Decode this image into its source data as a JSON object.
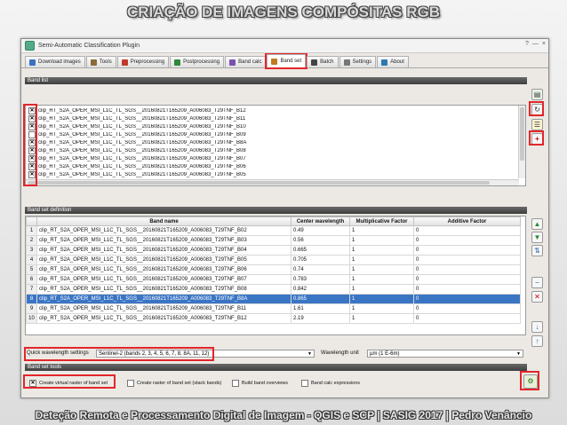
{
  "slide": {
    "title": "CRIAÇÃO DE IMAGENS COMPÓSITAS RGB",
    "footer": "Deteção Remota e Processamento Digital de Imagem - QGIS e SCP   |   SASIG 2017   |   Pedro Venâncio"
  },
  "window": {
    "title": "Semi-Automatic Classification Plugin",
    "controls": [
      "?",
      "—",
      "×"
    ]
  },
  "tabs": [
    {
      "label": "Download images",
      "icon_color": "#3a6fc4",
      "active": false
    },
    {
      "label": "Tools",
      "icon_color": "#8a6a3a",
      "active": false
    },
    {
      "label": "Preprocessing",
      "icon_color": "#c0392b",
      "active": false
    },
    {
      "label": "Postprocessing",
      "icon_color": "#2c8a3a",
      "active": false
    },
    {
      "label": "Band calc",
      "icon_color": "#7a4fb0",
      "active": false
    },
    {
      "label": "Band set",
      "icon_color": "#c07a20",
      "active": true
    },
    {
      "label": "Batch",
      "icon_color": "#444444",
      "active": false
    },
    {
      "label": "Settings",
      "icon_color": "#777777",
      "active": false
    },
    {
      "label": "About",
      "icon_color": "#2a7ab0",
      "active": false
    }
  ],
  "band_list": {
    "header": "Band list",
    "items": [
      {
        "checked": true,
        "name": "clip_RT_S2A_OPER_MSI_L1C_TL_SGS__20160821T165209_A006083_T29TNF_B12"
      },
      {
        "checked": true,
        "name": "clip_RT_S2A_OPER_MSI_L1C_TL_SGS__20160821T165209_A006083_T29TNF_B11"
      },
      {
        "checked": true,
        "name": "clip_RT_S2A_OPER_MSI_L1C_TL_SGS__20160821T165209_A006083_T29TNF_B10"
      },
      {
        "checked": false,
        "name": "clip_RT_S2A_OPER_MSI_L1C_TL_SGS__20160821T165209_A006083_T29TNF_B09"
      },
      {
        "checked": true,
        "name": "clip_RT_S2A_OPER_MSI_L1C_TL_SGS__20160821T165209_A006083_T29TNF_B8A"
      },
      {
        "checked": true,
        "name": "clip_RT_S2A_OPER_MSI_L1C_TL_SGS__20160821T165209_A006083_T29TNF_B08"
      },
      {
        "checked": true,
        "name": "clip_RT_S2A_OPER_MSI_L1C_TL_SGS__20160821T165209_A006083_T29TNF_B07"
      },
      {
        "checked": true,
        "name": "clip_RT_S2A_OPER_MSI_L1C_TL_SGS__20160821T165209_A006083_T29TNF_B06"
      },
      {
        "checked": true,
        "name": "clip_RT_S2A_OPER_MSI_L1C_TL_SGS__20160821T165209_A006083_T29TNF_B05"
      }
    ]
  },
  "band_set_definition": {
    "header": "Band set definition",
    "columns": [
      "Band name",
      "Center wavelength",
      "Multiplicative Factor",
      "Additive Factor"
    ],
    "rows": [
      {
        "n": "1",
        "name": "clip_RT_S2A_OPER_MSI_L1C_TL_SGS__20160821T165209_A006083_T29TNF_B02",
        "wl": "0.49",
        "mult": "1",
        "add": "0"
      },
      {
        "n": "2",
        "name": "clip_RT_S2A_OPER_MSI_L1C_TL_SGS__20160821T165209_A006083_T29TNF_B03",
        "wl": "0.56",
        "mult": "1",
        "add": "0"
      },
      {
        "n": "3",
        "name": "clip_RT_S2A_OPER_MSI_L1C_TL_SGS__20160821T165209_A006083_T29TNF_B04",
        "wl": "0.665",
        "mult": "1",
        "add": "0"
      },
      {
        "n": "4",
        "name": "clip_RT_S2A_OPER_MSI_L1C_TL_SGS__20160821T165209_A006083_T29TNF_B05",
        "wl": "0.705",
        "mult": "1",
        "add": "0"
      },
      {
        "n": "5",
        "name": "clip_RT_S2A_OPER_MSI_L1C_TL_SGS__20160821T165209_A006083_T29TNF_B06",
        "wl": "0.74",
        "mult": "1",
        "add": "0"
      },
      {
        "n": "6",
        "name": "clip_RT_S2A_OPER_MSI_L1C_TL_SGS__20160821T165209_A006083_T29TNF_B07",
        "wl": "0.783",
        "mult": "1",
        "add": "0"
      },
      {
        "n": "7",
        "name": "clip_RT_S2A_OPER_MSI_L1C_TL_SGS__20160821T165209_A006083_T29TNF_B08",
        "wl": "0.842",
        "mult": "1",
        "add": "0"
      },
      {
        "n": "8",
        "name": "clip_RT_S2A_OPER_MSI_L1C_TL_SGS__20160821T165209_A006083_T29TNF_B8A",
        "wl": "0.865",
        "mult": "1",
        "add": "0",
        "selected": true
      },
      {
        "n": "9",
        "name": "clip_RT_S2A_OPER_MSI_L1C_TL_SGS__20160821T165209_A006083_T29TNF_B11",
        "wl": "1.61",
        "mult": "1",
        "add": "0"
      },
      {
        "n": "10",
        "name": "clip_RT_S2A_OPER_MSI_L1C_TL_SGS__20160821T165209_A006083_T29TNF_B12",
        "wl": "2.19",
        "mult": "1",
        "add": "0"
      }
    ]
  },
  "wavelength": {
    "quick_label": "Quick wavelength settings",
    "quick_value": "Sentinel-2 (bands 2, 3, 4, 5, 6, 7, 8, 8A, 11, 12)",
    "unit_label": "Wavelength unit",
    "unit_value": "µm (1 E-6m)"
  },
  "band_set_tools": {
    "header": "Band set tools",
    "options": [
      {
        "checked": true,
        "label": "Create virtual raster of band set"
      },
      {
        "checked": false,
        "label": "Create raster of band set (stack bands)"
      },
      {
        "checked": false,
        "label": "Build band overviews"
      },
      {
        "checked": false,
        "label": "Band calc expressions"
      }
    ]
  },
  "icons": {
    "side_top": [
      "add-layer-icon",
      "refresh-icon",
      "select-all-icon",
      "add-band-icon"
    ],
    "side_table": [
      "move-up-icon",
      "move-down-icon",
      "sort-icon",
      "remove-band-icon",
      "clear-icon",
      "import-icon",
      "export-icon"
    ],
    "run": "run-icon"
  },
  "accent_colors": {
    "highlight": "#e3262b",
    "selection": "#3a75c4"
  }
}
